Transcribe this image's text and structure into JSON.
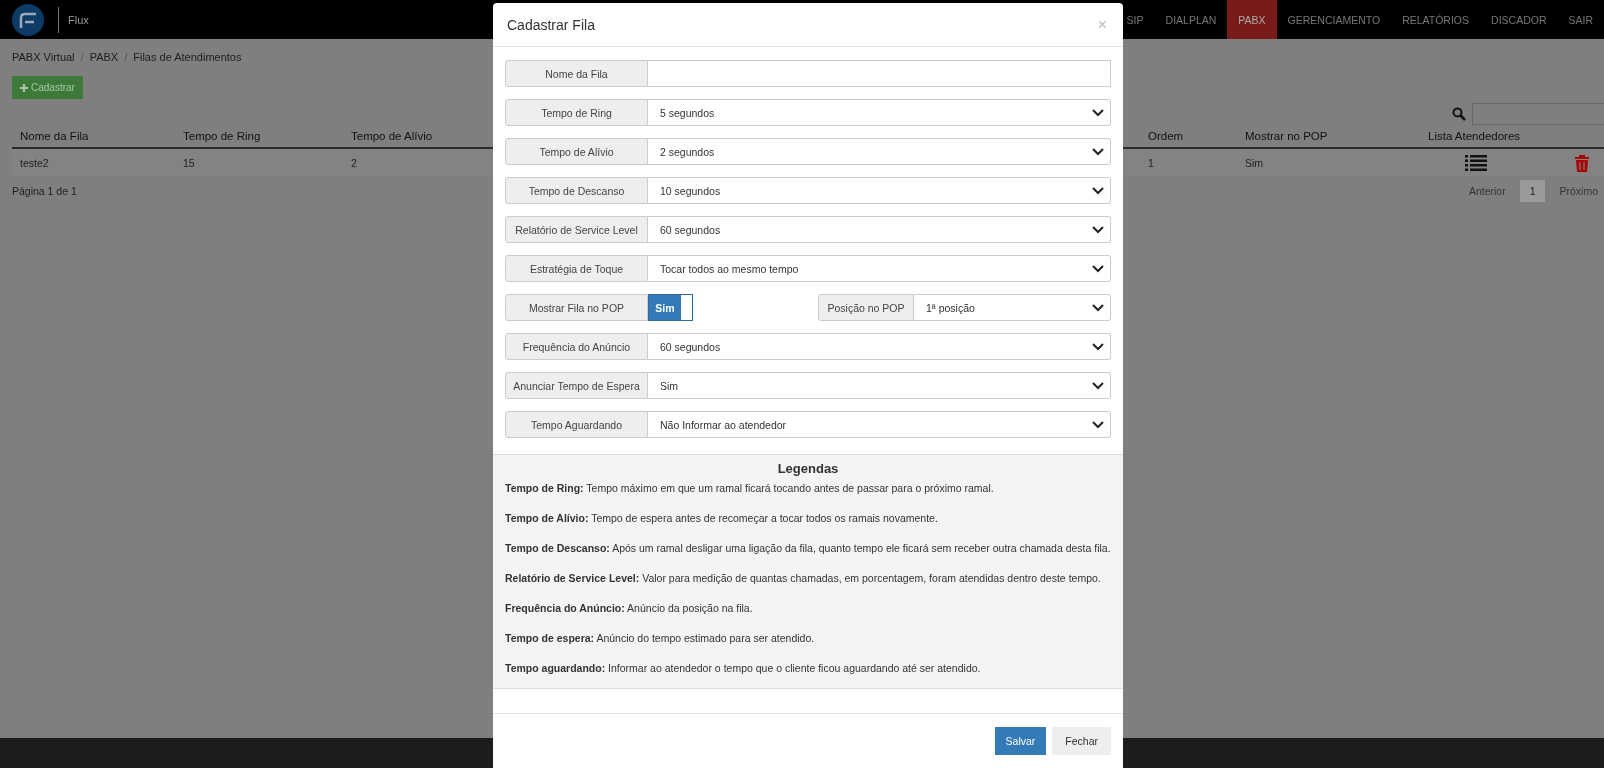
{
  "navbar": {
    "brand": "Flux",
    "items": [
      {
        "label": "SIP",
        "selected": false
      },
      {
        "label": "DIALPLAN",
        "selected": false
      },
      {
        "label": "PABX",
        "selected": true
      },
      {
        "label": "GERENCIAMENTO",
        "selected": false
      },
      {
        "label": "RELATÓRIOS",
        "selected": false
      },
      {
        "label": "DISCADOR",
        "selected": false
      },
      {
        "label": "SAIR",
        "selected": false
      }
    ]
  },
  "breadcrumb": {
    "separator": "/",
    "items": [
      "PABX Virtual",
      "PABX",
      "Filas de Atendimentos"
    ]
  },
  "add_button": "Cadastrar",
  "table": {
    "columns": [
      "Nome da Fila",
      "Tempo de Ring",
      "Tempo de Alívio",
      "Ordem",
      "Mostrar no POP",
      "Lista Atendedores"
    ],
    "rows": [
      {
        "cells": [
          "teste2",
          "15",
          "2",
          "1",
          "Sim"
        ]
      }
    ]
  },
  "pagination": {
    "summary": "Página 1 de 1",
    "previous": "Anterior",
    "pages": [
      {
        "label": "1",
        "selected": true
      }
    ],
    "next": "Próximo"
  },
  "modal": {
    "title": "Cadastrar Fila",
    "close": "×",
    "fields": [
      {
        "kind": "text",
        "label": "Nome da Fila"
      },
      {
        "kind": "select",
        "label": "Tempo de Ring",
        "value": "5 segundos"
      },
      {
        "kind": "select",
        "label": "Tempo de Alívio",
        "value": "2 segundos"
      },
      {
        "kind": "select",
        "label": "Tempo de Descanso",
        "value": "10 segundos"
      },
      {
        "kind": "select",
        "label": "Relatório de Service Level",
        "value": "60 segundos"
      },
      {
        "kind": "select",
        "label": "Estratégia de Toque",
        "value": "Tocar todos ao mesmo tempo"
      },
      {
        "kind": "toggle",
        "label": "Mostrar Fila no POP",
        "value": "Sim",
        "on": true,
        "side_label": "Posição no POP",
        "side_value": "1ª posição"
      },
      {
        "kind": "select",
        "label": "Frequência do Anúncio",
        "value": "60 segundos"
      },
      {
        "kind": "select",
        "label": "Anunciar Tempo de Espera",
        "value": "Sim"
      },
      {
        "kind": "select",
        "label": "Tempo Aguardando",
        "value": "Não Informar ao atendedor"
      }
    ],
    "legend_title": "Legendas",
    "legend": [
      "**Tempo de Ring:** Tempo máximo em que um ramal ficará tocando antes de passar para o próximo ramal.",
      "**Tempo de Alívio:** Tempo de espera antes de recomeçar a tocar todos os ramais novamente.",
      "**Tempo de Descanso:** Após um ramal desligar uma ligação da fila, quanto tempo ele ficará sem receber outra chamada desta fila.",
      "**Relatório de Service Level:** Valor para medição de quantas chamadas, em porcentagem, foram atendidas dentro deste tempo.",
      "**Frequência do Anúncio:** Anúncio da posição na fila.",
      "**Tempo de espera:** Anúncio do tempo estimado para ser atendido.",
      "**Tempo aguardando:** Informar ao atendedor o tempo que o cliente ficou aguardando até ser atendido."
    ],
    "buttons": [
      {
        "label": "Salvar",
        "kind": "primary"
      },
      {
        "label": "Fechar",
        "kind": "default"
      }
    ]
  }
}
